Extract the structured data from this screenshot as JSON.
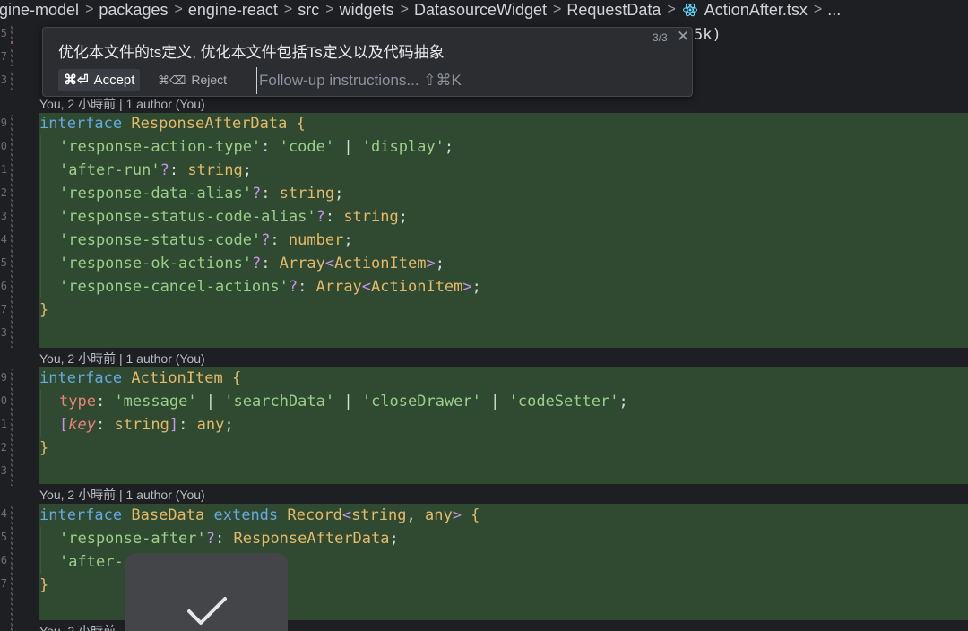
{
  "breadcrumb": [
    "gine-model",
    "packages",
    "engine-react",
    "src",
    "widgets",
    "DatasourceWidget",
    "RequestData",
    "ActionAfter.tsx",
    "..."
  ],
  "breadcrumb_file_icon": "react-icon",
  "popup": {
    "prompt": "优化本文件的ts定义, 优化本文件包括Ts定义以及代码抽象",
    "counter": "3/3",
    "close_icon": "close-icon",
    "accept_shortcut": "⌘⏎",
    "accept_label": "Accept",
    "reject_shortcut": "⌘⌫",
    "reject_label": "Reject",
    "followup_placeholder": "Follow-up instructions... ⇧⌘K",
    "tail_text": "5k)"
  },
  "annotations": {
    "a1": "You, 2 小時前 | 1 author (You)",
    "a2": "You, 2 小時前 | 1 author (You)",
    "a3": "You, 2 小時前 | 1 author (You)",
    "a4": "You, 2 小時前"
  },
  "gutter_numbers": [
    "5",
    "7",
    "3",
    "",
    "9",
    "0",
    "1",
    "2",
    "3",
    "4",
    "5",
    "6",
    "7",
    "3",
    "",
    "9",
    "0",
    "1",
    "2",
    "3",
    "",
    "4",
    "5",
    "6",
    "7"
  ],
  "code": {
    "l1_kw": "interface",
    "l1_name": "ResponseAfterData",
    "l1_brace": " {",
    "l2_key": "'response-action-type'",
    "l2_rest": ": ",
    "l2_v1": "'code'",
    "l2_pipe": " | ",
    "l2_v2": "'display'",
    "l2_end": ";",
    "l3_key": "'after-run'",
    "l3_q": "?",
    "l3_colon": ": ",
    "l3_type": "string",
    "l3_end": ";",
    "l4_key": "'response-data-alias'",
    "l4_q": "?",
    "l4_colon": ": ",
    "l4_type": "string",
    "l4_end": ";",
    "l5_key": "'response-status-code-alias'",
    "l5_q": "?",
    "l5_colon": ": ",
    "l5_type": "string",
    "l5_end": ";",
    "l6_key": "'response-status-code'",
    "l6_q": "?",
    "l6_colon": ": ",
    "l6_type": "number",
    "l6_end": ";",
    "l7_key": "'response-ok-actions'",
    "l7_q": "?",
    "l7_colon": ": ",
    "l7_type": "Array",
    "l7_lt": "<",
    "l7_gen": "ActionItem",
    "l7_gt": ">",
    "l7_end": ";",
    "l8_key": "'response-cancel-actions'",
    "l8_q": "?",
    "l8_colon": ": ",
    "l8_type": "Array",
    "l8_lt": "<",
    "l8_gen": "ActionItem",
    "l8_gt": ">",
    "l8_end": ";",
    "l9_brace": "}",
    "m1_kw": "interface",
    "m1_name": "ActionItem",
    "m1_brace": " {",
    "m2_prop": "type",
    "m2_colon": ": ",
    "m2_v1": "'message'",
    "m2_p1": " | ",
    "m2_v2": "'searchData'",
    "m2_p2": " | ",
    "m2_v3": "'closeDrawer'",
    "m2_p3": " | ",
    "m2_v4": "'codeSetter'",
    "m2_end": ";",
    "m3_open": "[",
    "m3_key": "key",
    "m3_colon": ": ",
    "m3_type": "string",
    "m3_close": "]",
    "m3_colon2": ": ",
    "m3_any": "any",
    "m3_end": ";",
    "m4_brace": "}",
    "n1_kw": "interface",
    "n1_name": "BaseData",
    "n1_ext": " extends ",
    "n1_rec": "Record",
    "n1_lt": "<",
    "n1_t1": "string",
    "n1_comma": ", ",
    "n1_t2": "any",
    "n1_gt": ">",
    "n1_brace": " {",
    "n2_key": "'response-after'",
    "n2_q": "?",
    "n2_colon": ": ",
    "n2_type": "ResponseAfterData",
    "n2_end": ";",
    "n3_key": "'after-",
    "n4_brace": "}"
  },
  "toast": {
    "icon": "checkmark-icon"
  },
  "colors": {
    "added_block": "#2f4a31",
    "keyword": "#66a9e0",
    "type": "#e3b96a",
    "string": "#9bcf89",
    "property": "#e8817a"
  }
}
